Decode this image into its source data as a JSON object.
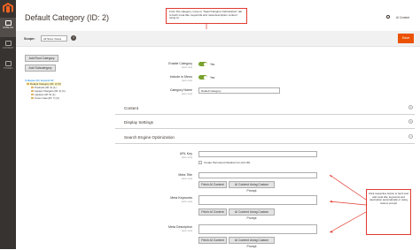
{
  "sidebar": {
    "items": [
      {
        "label": "CATALOG",
        "active": true
      },
      {
        "label": "CONTENT",
        "active": false
      },
      {
        "label": "STORES",
        "active": false
      }
    ]
  },
  "header": {
    "title": "Default Category (ID: 2)",
    "user": "AI Content"
  },
  "callouts": {
    "top": "From this category, move to \"Search Engine Optimization\" tab to fetch meta title, keywords and meta description content using AI",
    "right": "Click respective button to fetch and add meta title, keywords and description automatically or using custom prompt"
  },
  "scope": {
    "label": "Scope:",
    "value": "All Store Views",
    "help": "?"
  },
  "toolbar": {
    "save_label": "Save"
  },
  "tree": {
    "add_root_label": "Add Root Category",
    "add_sub_label": "Add Subcategory",
    "controls": "Collapse All | Expand All",
    "items": [
      {
        "label": "Default Category (ID: 2) (5)",
        "level": 0,
        "selected": true
      },
      {
        "label": "Products (ID: 3) (1)",
        "level": 1,
        "selected": false
      },
      {
        "label": "Laptop Chargers (ID: 4) (1)",
        "level": 1,
        "selected": false
      },
      {
        "label": "Laptops (ID: 5) (1)",
        "level": 1,
        "selected": false
      },
      {
        "label": "Cover case (ID: 7) (2)",
        "level": 1,
        "selected": false
      }
    ]
  },
  "form": {
    "enable_label": "Enable Category",
    "enable_scope": "[store view]",
    "enable_value": "Yes",
    "menu_label": "Include in Menu",
    "menu_scope": "[store view]",
    "menu_value": "Yes",
    "name_label": "Category Name",
    "name_scope": "[store view]",
    "name_value": "Default Category"
  },
  "sections": {
    "content": "Content",
    "display": "Display Settings",
    "seo": "Search Engine Optimization"
  },
  "seo": {
    "url_key_label": "URL Key",
    "url_key_scope": "[store view]",
    "redirect_label": "Create Permanent Redirect for old URL",
    "meta_title_label": "Meta Title",
    "meta_title_scope": "[store view]",
    "meta_keywords_label": "Meta Keywords",
    "meta_keywords_scope": "[store view]",
    "meta_desc_label": "Meta Description",
    "meta_desc_scope": "[store view]",
    "fetch_label": "Fetch AI Content",
    "custom_label": "AI Content Using Custom Prompt"
  },
  "colors": {
    "accent": "#eb5202",
    "sidebar": "#373330",
    "callout_border": "#e03a2e",
    "toggle_on": "#79a22e"
  }
}
